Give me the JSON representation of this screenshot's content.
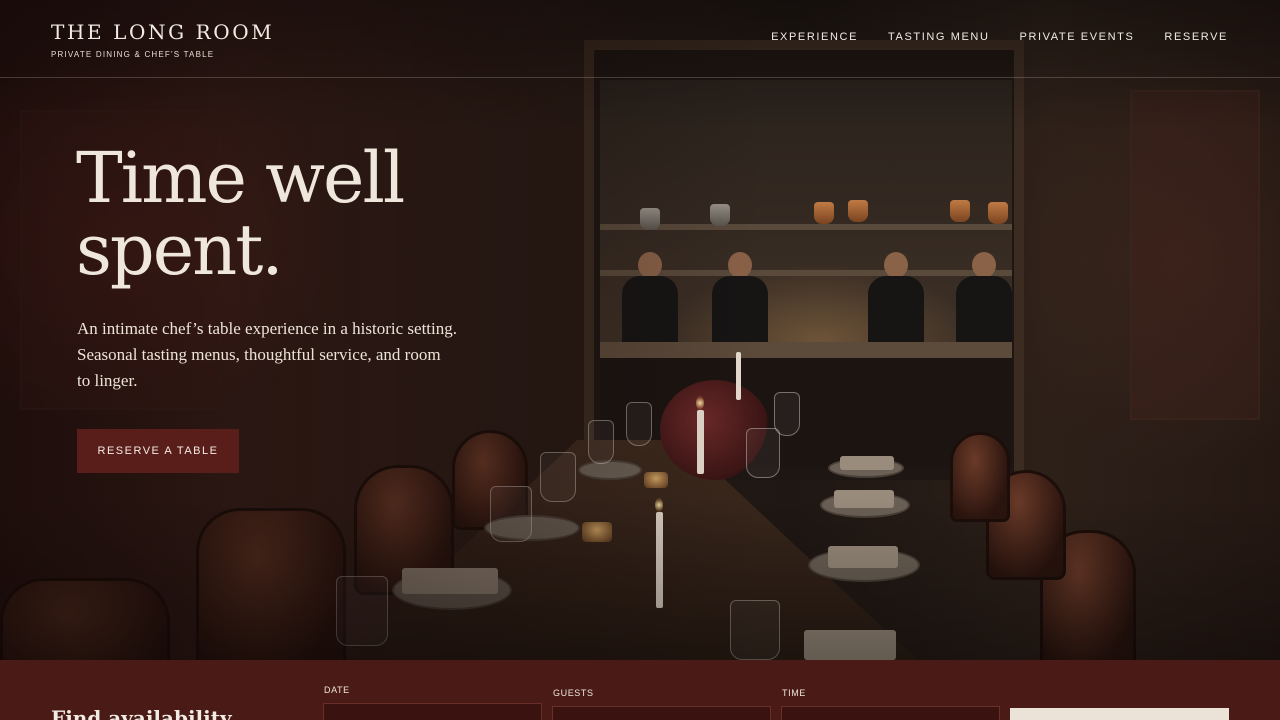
{
  "brand": {
    "name": "THE LONG ROOM",
    "tagline": "PRIVATE DINING & CHEF'S TABLE"
  },
  "nav": {
    "items": [
      {
        "label": "EXPERIENCE"
      },
      {
        "label": "TASTING MENU"
      },
      {
        "label": "PRIVATE EVENTS"
      },
      {
        "label": "RESERVE"
      }
    ]
  },
  "hero": {
    "title": "Time well spent.",
    "subtitle": "An intimate chef’s table experience in a historic setting. Seasonal tasting menus, thoughtful service, and room to linger.",
    "cta_label": "RESERVE A TABLE"
  },
  "booking": {
    "title": "Find availability",
    "fields": [
      {
        "label": "DATE"
      },
      {
        "label": "GUESTS"
      },
      {
        "label": "TIME"
      }
    ]
  },
  "colors": {
    "accent": "#5a1e1a",
    "booking_bar": "#4a1a17",
    "text_light": "#efe7dc"
  }
}
